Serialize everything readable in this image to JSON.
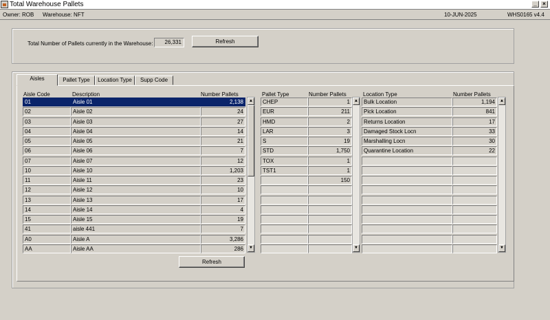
{
  "window": {
    "title": "Total Warehouse Pallets",
    "min_glyph": "_",
    "close_glyph": "×"
  },
  "info": {
    "owner": "Owner:  ROB",
    "warehouse": "Warehouse:  NFT",
    "date": "10-JUN-2025",
    "program": "WHS0165  v4.4"
  },
  "summary": {
    "label": "Total Number of Pallets currently in the Warehouse:",
    "value": "26,331",
    "refresh": "Refresh"
  },
  "tabs": [
    "Aisles",
    "Pallet Type",
    "Location Type",
    "Supp Code"
  ],
  "aisles": {
    "headers": [
      "Aisle Code",
      "Description",
      "Number Pallets"
    ],
    "rows": [
      [
        "01",
        "Aisle 01",
        "2,138"
      ],
      [
        "02",
        "Aisle 02",
        "24"
      ],
      [
        "03",
        "Aisle 03",
        "27"
      ],
      [
        "04",
        "Aisle 04",
        "14"
      ],
      [
        "05",
        "Aisle 05",
        "21"
      ],
      [
        "06",
        "Aisle 06",
        "7"
      ],
      [
        "07",
        "Aisle 07",
        "12"
      ],
      [
        "10",
        "Aisle 10",
        "1,203"
      ],
      [
        "11",
        "Aisle 11",
        "23"
      ],
      [
        "12",
        "Aisle 12",
        "10"
      ],
      [
        "13",
        "Aisle 13",
        "17"
      ],
      [
        "14",
        "Aisle 14",
        "4"
      ],
      [
        "15",
        "Aisle 15",
        "19"
      ],
      [
        "41",
        "aisle 441",
        "7"
      ],
      [
        "A0",
        "Aisle A",
        "3,286"
      ],
      [
        "AA",
        "Aisle AA",
        "286"
      ]
    ]
  },
  "pallet_types": {
    "headers": [
      "Pallet Type",
      "Number Pallets"
    ],
    "rows": [
      [
        "CHEP",
        "1"
      ],
      [
        "EUR",
        "211"
      ],
      [
        "HMD",
        "2"
      ],
      [
        "LAR",
        "3"
      ],
      [
        "S",
        "19"
      ],
      [
        "STD",
        "1,750"
      ],
      [
        "TOX",
        "1"
      ],
      [
        "TST1",
        "1"
      ],
      [
        "",
        "150"
      ],
      [
        "",
        ""
      ],
      [
        "",
        ""
      ],
      [
        "",
        ""
      ],
      [
        "",
        ""
      ],
      [
        "",
        ""
      ],
      [
        "",
        ""
      ],
      [
        "",
        ""
      ]
    ]
  },
  "location_types": {
    "headers": [
      "Location Type",
      "Number Pallets"
    ],
    "rows": [
      [
        "Bulk Location",
        "1,194"
      ],
      [
        "Pick Location",
        "841"
      ],
      [
        "Returns Location",
        "17"
      ],
      [
        "Damaged Stock Locn",
        "33"
      ],
      [
        "Marshalling Locn",
        "30"
      ],
      [
        "Quarantine Location",
        "22"
      ],
      [
        "",
        ""
      ],
      [
        "",
        ""
      ],
      [
        "",
        ""
      ],
      [
        "",
        ""
      ],
      [
        "",
        ""
      ],
      [
        "",
        ""
      ],
      [
        "",
        ""
      ],
      [
        "",
        ""
      ],
      [
        "",
        ""
      ],
      [
        "",
        ""
      ]
    ]
  },
  "grid_refresh": "Refresh",
  "scroll_up": "▲",
  "scroll_down": "▼"
}
